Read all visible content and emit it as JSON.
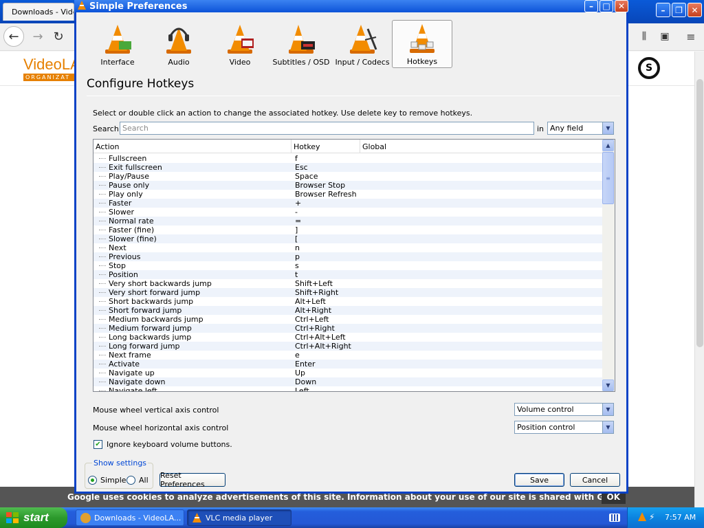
{
  "browser": {
    "tab_title": "Downloads - Vide",
    "logo_text": "VideoLA",
    "logo_sub": "ORGANIZAT",
    "cookie_text": "Google uses cookies to analyze advertisements of this site. Information about your use of our site is shared with Google for that purpose.",
    "cookie_ok": "OK"
  },
  "dialog": {
    "title": "Simple Preferences",
    "categories": [
      {
        "label": "Interface"
      },
      {
        "label": "Audio"
      },
      {
        "label": "Video"
      },
      {
        "label": "Subtitles / OSD"
      },
      {
        "label": "Input / Codecs"
      },
      {
        "label": "Hotkeys"
      }
    ],
    "section_title": "Configure Hotkeys",
    "instructions": "Select or double click an action to change the associated hotkey. Use delete key to remove hotkeys.",
    "search_label": "Search",
    "search_placeholder": "Search",
    "in_label": "in",
    "field_select": "Any field",
    "columns": {
      "action": "Action",
      "hotkey": "Hotkey",
      "global": "Global"
    },
    "hotkeys": [
      {
        "action": "Fullscreen",
        "hotkey": "f"
      },
      {
        "action": "Exit fullscreen",
        "hotkey": "Esc"
      },
      {
        "action": "Play/Pause",
        "hotkey": "Space"
      },
      {
        "action": "Pause only",
        "hotkey": "Browser Stop"
      },
      {
        "action": "Play only",
        "hotkey": "Browser Refresh"
      },
      {
        "action": "Faster",
        "hotkey": "+"
      },
      {
        "action": "Slower",
        "hotkey": "-"
      },
      {
        "action": "Normal rate",
        "hotkey": "="
      },
      {
        "action": "Faster (fine)",
        "hotkey": "]"
      },
      {
        "action": "Slower (fine)",
        "hotkey": "["
      },
      {
        "action": "Next",
        "hotkey": "n"
      },
      {
        "action": "Previous",
        "hotkey": "p"
      },
      {
        "action": "Stop",
        "hotkey": "s"
      },
      {
        "action": "Position",
        "hotkey": "t"
      },
      {
        "action": "Very short backwards jump",
        "hotkey": "Shift+Left"
      },
      {
        "action": "Very short forward jump",
        "hotkey": "Shift+Right"
      },
      {
        "action": "Short backwards jump",
        "hotkey": "Alt+Left"
      },
      {
        "action": "Short forward jump",
        "hotkey": "Alt+Right"
      },
      {
        "action": "Medium backwards jump",
        "hotkey": "Ctrl+Left"
      },
      {
        "action": "Medium forward jump",
        "hotkey": "Ctrl+Right"
      },
      {
        "action": "Long backwards jump",
        "hotkey": "Ctrl+Alt+Left"
      },
      {
        "action": "Long forward jump",
        "hotkey": "Ctrl+Alt+Right"
      },
      {
        "action": "Next frame",
        "hotkey": "e"
      },
      {
        "action": "Activate",
        "hotkey": "Enter"
      },
      {
        "action": "Navigate up",
        "hotkey": "Up"
      },
      {
        "action": "Navigate down",
        "hotkey": "Down"
      },
      {
        "action": "Navigate left",
        "hotkey": "Left"
      }
    ],
    "mouse_vertical_label": "Mouse wheel vertical axis control",
    "mouse_vertical_value": "Volume control",
    "mouse_horizontal_label": "Mouse wheel horizontal axis control",
    "mouse_horizontal_value": "Position control",
    "ignore_volume_label": "Ignore keyboard volume buttons.",
    "show_settings_label": "Show settings",
    "simple_label": "Simple",
    "all_label": "All",
    "reset_button": "Reset Preferences",
    "save_button": "Save",
    "cancel_button": "Cancel"
  },
  "taskbar": {
    "start_label": "start",
    "tasks": [
      {
        "label": "Downloads - VideoLA..."
      },
      {
        "label": "VLC media player"
      }
    ],
    "time": "7:57 AM"
  },
  "colors": {
    "xp_blue": "#0842c6",
    "vlc_orange": "#e68000",
    "start_green": "#2d9a2d",
    "row_stripe": "#eef3fb"
  },
  "icons": [
    "cone-icon",
    "headphones-icon",
    "film-icon",
    "subtitles-icon",
    "codec-icon",
    "hotkeys-icon"
  ]
}
